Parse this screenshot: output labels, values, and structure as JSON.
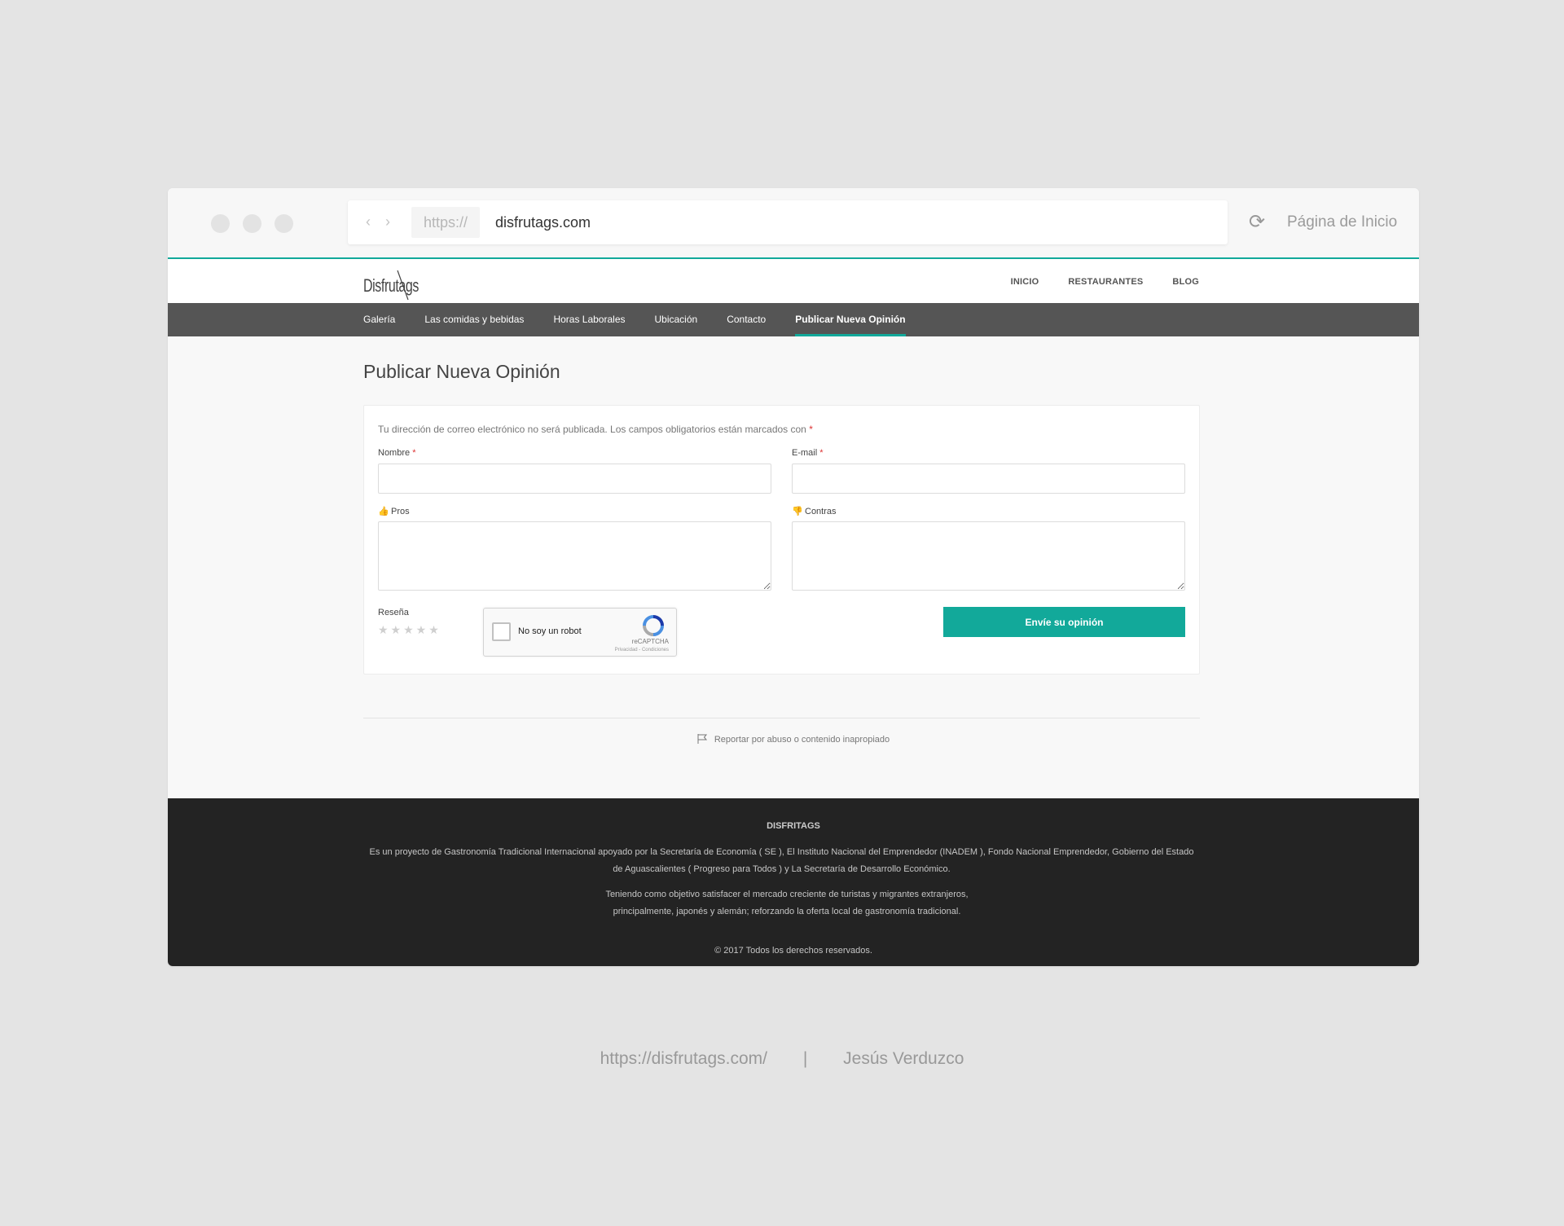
{
  "browser": {
    "protocol": "https://",
    "domain": "disfrutags.com",
    "home_link": "Página de Inicio"
  },
  "site": {
    "logo": "Disfrutags",
    "top_nav": [
      "INICIO",
      "RESTAURANTES",
      "BLOG"
    ],
    "sub_nav": [
      "Galería",
      "Las comidas y bebidas",
      "Horas Laborales",
      "Ubicación",
      "Contacto",
      "Publicar Nueva Opinión"
    ],
    "active_sub_nav": "Publicar Nueva Opinión"
  },
  "form": {
    "title": "Publicar Nueva Opinión",
    "notice": "Tu dirección de correo electrónico no será publicada. Los campos obligatorios están marcados con",
    "required_mark": "*",
    "name_label": "Nombre",
    "email_label": "E-mail",
    "pros_label": "Pros",
    "cons_label": "Contras",
    "review_label": "Reseña",
    "stars": "★★★★★",
    "rating": 0,
    "captcha_text": "No soy un robot",
    "captcha_brand": "reCAPTCHA",
    "captcha_terms": "Privacidad - Condiciones",
    "submit_label": "Envíe su opinión",
    "report_text": "Reportar por abuso o contenido inapropiado"
  },
  "footer": {
    "title": "DISFRITAGS",
    "para1": "Es un proyecto de Gastronomía Tradicional Internacional apoyado por la Secretaría de Economía ( SE ), El Instituto Nacional del Emprendedor (INADEM ), Fondo Nacional Emprendedor, Gobierno del Estado de Aguascalientes ( Progreso para Todos ) y La Secretaría de Desarrollo Económico.",
    "para2": "Teniendo como objetivo satisfacer el mercado creciente de turistas y migrantes extranjeros, principalmente, japonés y alemán; reforzando la oferta local de gastronomía tradicional.",
    "copyright": "© 2017 Todos los derechos reservados."
  },
  "caption": {
    "url": "https://disfrutags.com/",
    "separator": "|",
    "author": "Jesús Verduzco"
  },
  "colors": {
    "accent": "#12a99a",
    "subnav_bg": "#555555",
    "footer_bg": "#232323",
    "page_bg": "#e4e4e4"
  }
}
